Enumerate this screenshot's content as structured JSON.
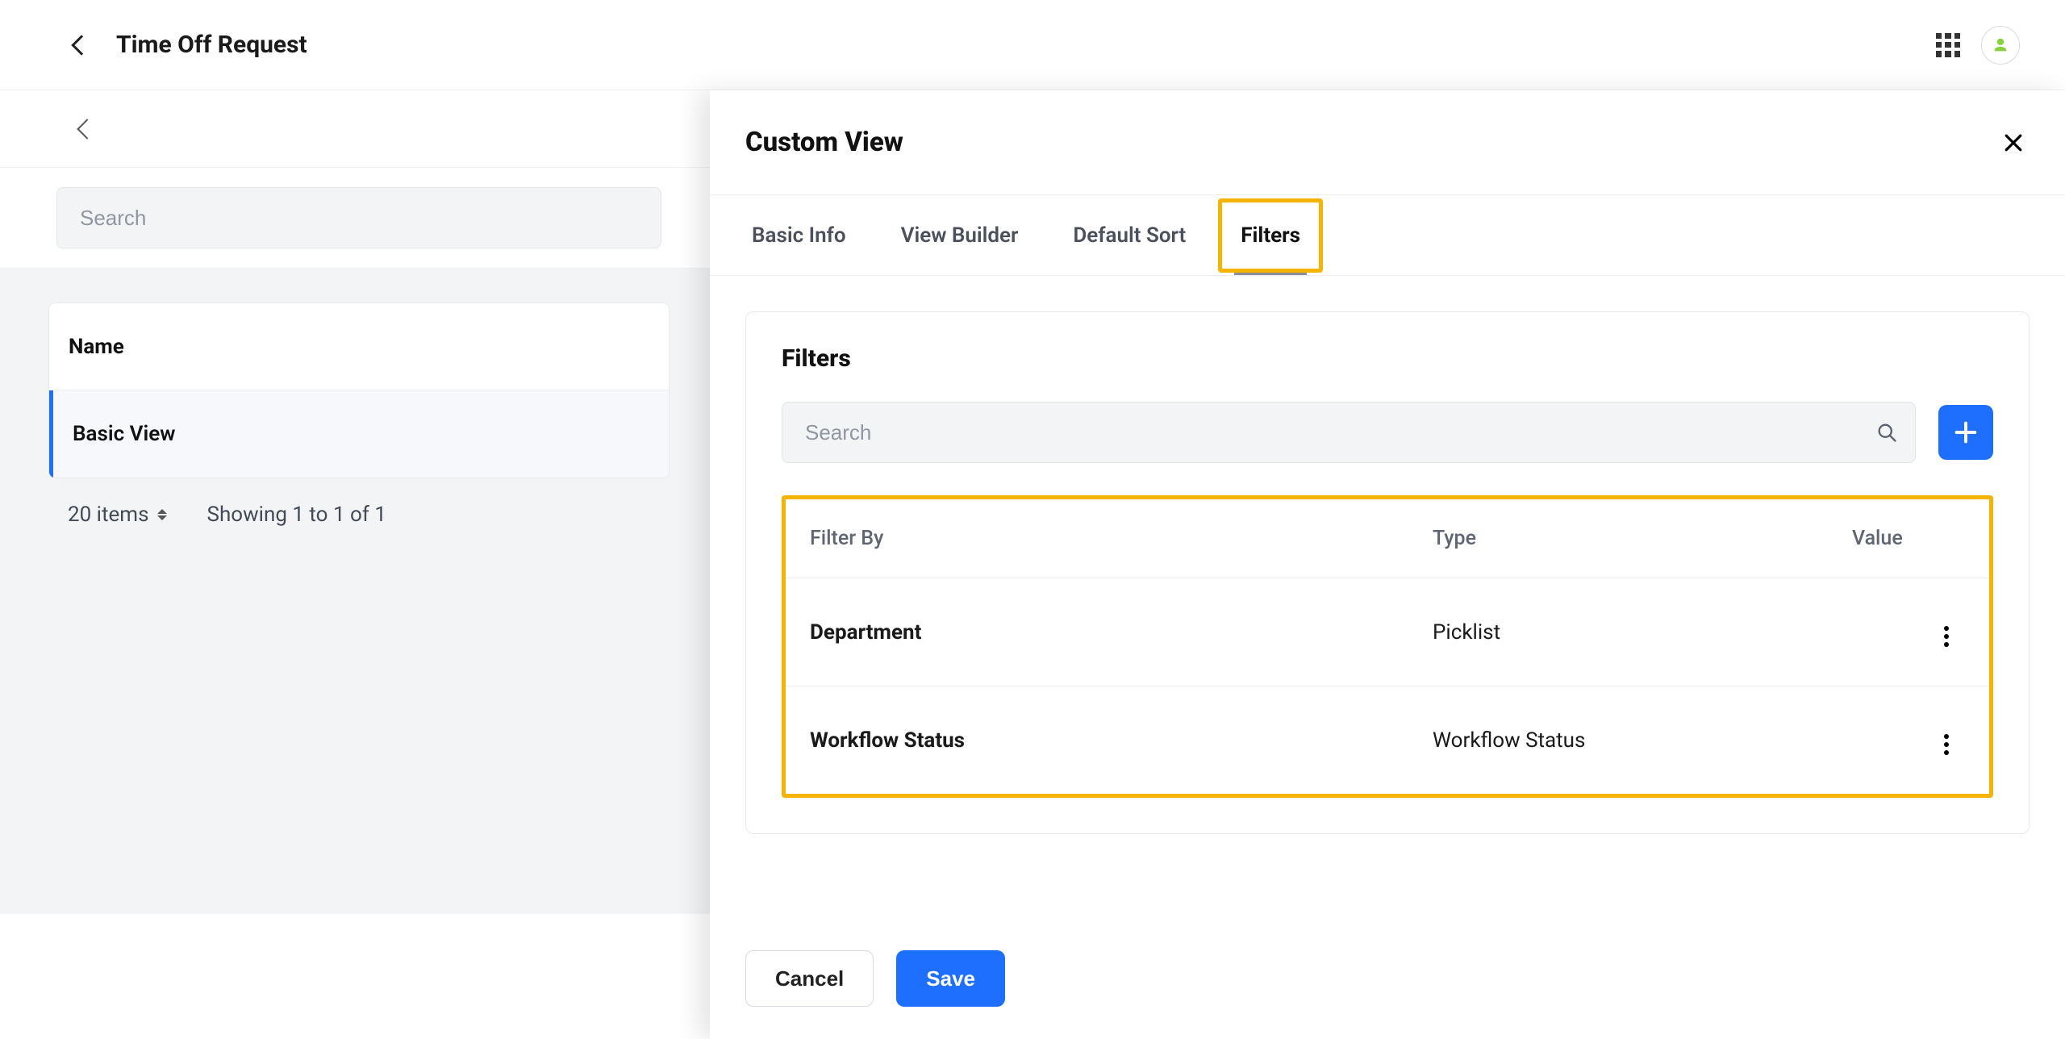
{
  "header": {
    "page_title": "Time Off Request"
  },
  "left_panel": {
    "search_placeholder": "Search",
    "list_header": "Name",
    "rows": [
      {
        "name": "Basic View"
      }
    ],
    "items_per_page": "20 items",
    "showing": "Showing 1 to 1 of 1"
  },
  "panel": {
    "title": "Custom View",
    "tabs": [
      {
        "label": "Basic Info"
      },
      {
        "label": "View Builder"
      },
      {
        "label": "Default Sort"
      },
      {
        "label": "Filters"
      }
    ],
    "active_tab_index": 3,
    "filters_section": {
      "title": "Filters",
      "search_placeholder": "Search",
      "columns": {
        "filter_by": "Filter By",
        "type": "Type",
        "value": "Value"
      },
      "rows": [
        {
          "filter_by": "Department",
          "type": "Picklist",
          "value": ""
        },
        {
          "filter_by": "Workflow Status",
          "type": "Workflow Status",
          "value": ""
        }
      ]
    },
    "footer": {
      "cancel": "Cancel",
      "save": "Save"
    }
  },
  "colors": {
    "accent": "#1f6fff",
    "highlight": "#f5b400"
  }
}
